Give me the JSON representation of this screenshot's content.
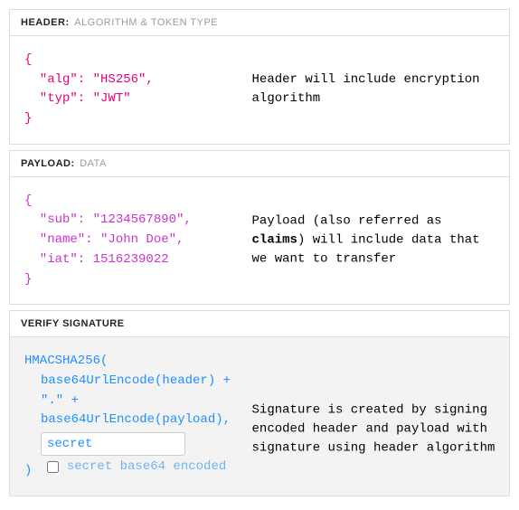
{
  "header_section": {
    "label": "HEADER:",
    "sub": "ALGORITHM & TOKEN TYPE",
    "code": "{\n  \"alg\": \"HS256\",\n  \"typ\": \"JWT\"\n}",
    "annotation": "Header will include encryption algorithm"
  },
  "payload_section": {
    "label": "PAYLOAD:",
    "sub": "DATA",
    "code": "{\n  \"sub\": \"1234567890\",\n  \"name\": \"John Doe\",\n  \"iat\": 1516239022\n}",
    "annotation_pre": "Payload (also referred as ",
    "annotation_bold": "claims",
    "annotation_post": ") will include data that we want to transfer"
  },
  "signature_section": {
    "label": "VERIFY SIGNATURE",
    "line1": "HMACSHA256(",
    "line2": "base64UrlEncode(header) + \".\" +",
    "line3": "base64UrlEncode(payload),",
    "secret_value": "secret",
    "line5_paren": ")",
    "checkbox_label": "secret base64 encoded",
    "annotation": "Signature is created by signing encoded header and payload with signature using header algorithm"
  }
}
